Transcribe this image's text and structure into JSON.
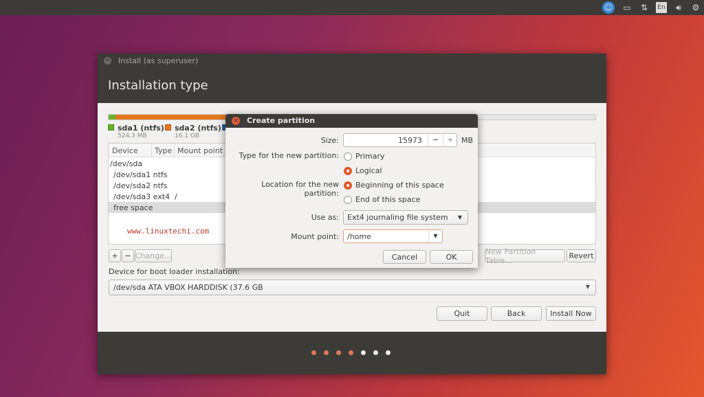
{
  "topbar": {
    "icons": [
      "accessibility-icon",
      "battery-icon",
      "network-icon",
      "keyboard-layout-icon",
      "volume-icon",
      "settings-gear-icon"
    ],
    "keyboard": "En"
  },
  "window": {
    "title": "Install (as superuser)",
    "heading": "Installation type"
  },
  "partition_bar": {
    "segments": [
      {
        "color": "#6ab22c",
        "label": "sda1 (ntfs)",
        "size": "524.3 MB"
      },
      {
        "color": "#e3781d",
        "label": "sda2 (ntfs)",
        "size": "16.1 GB"
      },
      {
        "color": "#2c5b9a"
      },
      {
        "color": "#e6e6e6"
      }
    ]
  },
  "table": {
    "columns": [
      "Device",
      "Type",
      "Mount point"
    ],
    "rows": [
      {
        "device": "/dev/sda",
        "type": "",
        "mount": ""
      },
      {
        "device": "/dev/sda1",
        "type": "ntfs",
        "mount": ""
      },
      {
        "device": "/dev/sda2",
        "type": "ntfs",
        "mount": ""
      },
      {
        "device": "/dev/sda3",
        "type": "ext4",
        "mount": "/"
      },
      {
        "device": "free space",
        "type": "",
        "mount": ""
      }
    ],
    "watermark": "www.linuxtechi.com"
  },
  "controls": {
    "add": "+",
    "remove": "−",
    "change": "Change...",
    "new_table": "New Partition Table...",
    "revert": "Revert"
  },
  "bootloader": {
    "label": "Device for boot loader installation:",
    "value": "/dev/sda   ATA VBOX HARDDISK (37.6 GB"
  },
  "buttons": {
    "quit": "Quit",
    "back": "Back",
    "install": "Install Now"
  },
  "progress": {
    "current_step": 4,
    "total_steps": 7,
    "active_color": "#e0795a"
  },
  "dialog": {
    "title": "Create partition",
    "size_label": "Size:",
    "size_value": "15973",
    "size_unit": "MB",
    "minus": "−",
    "plus": "+",
    "type_label": "Type for the new partition:",
    "type_options": [
      "Primary",
      "Logical"
    ],
    "type_selected": "Logical",
    "location_label": "Location for the new partition:",
    "location_options": [
      "Beginning of this space",
      "End of this space"
    ],
    "location_selected": "Beginning of this space",
    "use_as_label": "Use as:",
    "use_as_value": "Ext4 journaling file system",
    "mount_label": "Mount point:",
    "mount_value": "/home",
    "cancel": "Cancel",
    "ok": "OK"
  }
}
